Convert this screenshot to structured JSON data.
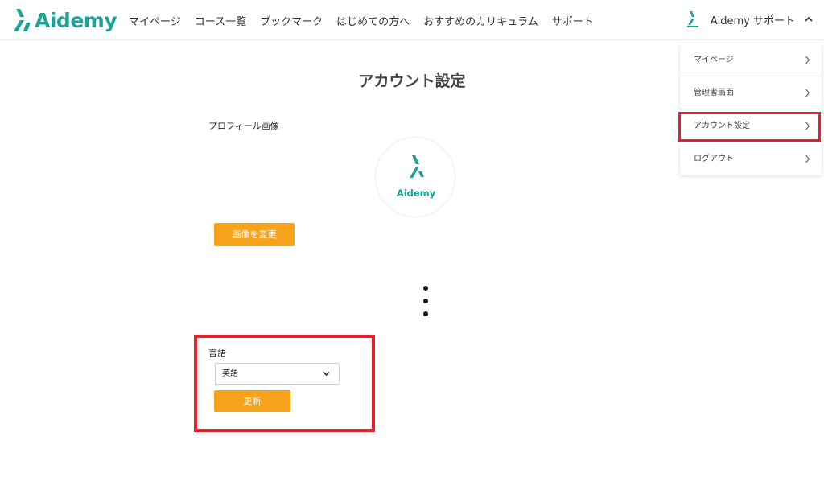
{
  "brand": {
    "name": "Aidemy",
    "color": "#1aa396"
  },
  "nav": {
    "items": [
      "マイページ",
      "コース一覧",
      "ブックマーク",
      "はじめての方へ",
      "おすすめのカリキュラム",
      "サポート"
    ]
  },
  "user": {
    "name": "Aidemy サポート",
    "logo_icon": "aidemy-logo-icon",
    "toggle_icon": "chevron-up-icon"
  },
  "dropdown": {
    "items": [
      {
        "label": "マイページ",
        "icon": "chevron-right-icon"
      },
      {
        "label": "管理者画面",
        "icon": "chevron-right-icon"
      },
      {
        "label": "アカウント設定",
        "icon": "chevron-right-icon",
        "highlighted": true
      },
      {
        "label": "ログアウト",
        "icon": "chevron-right-icon"
      }
    ]
  },
  "page": {
    "title": "アカウント設定",
    "profile_label": "プロフィール画像",
    "avatar_text": "Aidemy",
    "change_image_button": "画像を変更",
    "language_label": "言語",
    "language_selected": "英語",
    "update_button": "更新"
  },
  "colors": {
    "accent": "#f7a21b",
    "highlight": "#e3222b",
    "brand": "#1aa396"
  }
}
